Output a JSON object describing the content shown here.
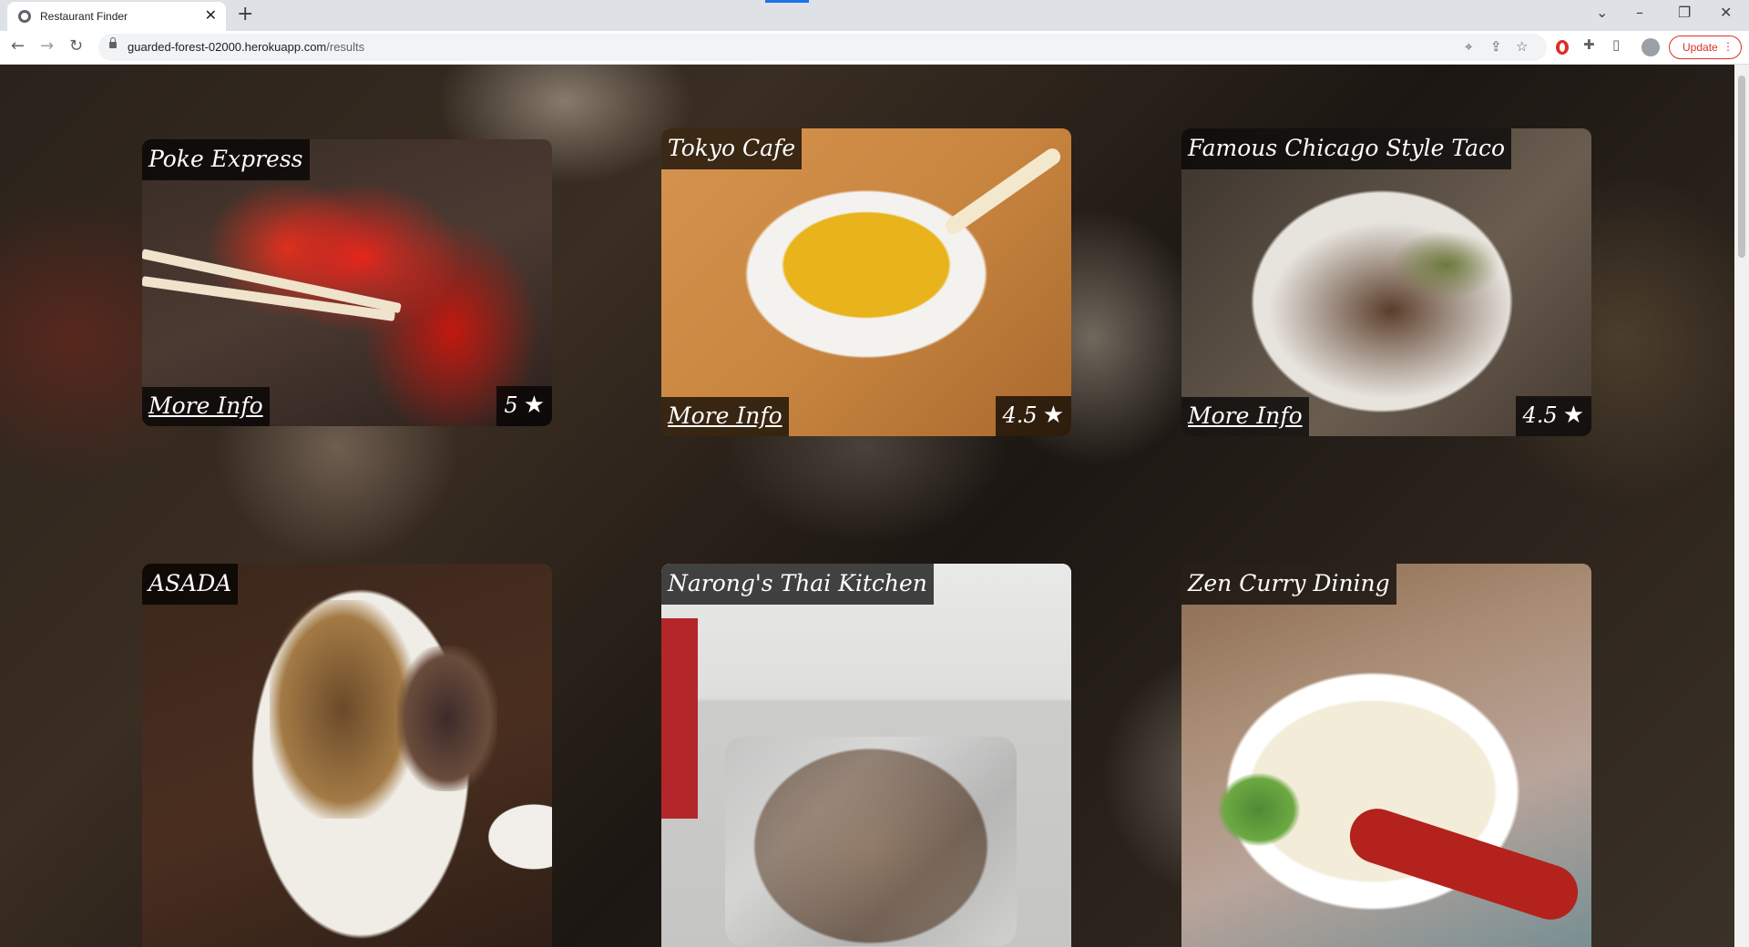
{
  "browser": {
    "tab_title": "Restaurant Finder",
    "tab_close": "✕",
    "new_tab": "+",
    "url_host": "guarded-forest-02000.herokuapp.com",
    "url_path": "/results",
    "update_label": "Update",
    "update_menu": "⋮",
    "nav_back": "←",
    "nav_forward": "→",
    "nav_reload": "↻",
    "win_minimize": "–",
    "win_maximize": "❐",
    "win_close": "✕",
    "tab_search": "⌄"
  },
  "restaurants": [
    {
      "name": "Poke Express",
      "more_info": "More Info",
      "rating": "5",
      "star": "★"
    },
    {
      "name": "Tokyo Cafe",
      "more_info": "More Info",
      "rating": "4.5",
      "star": "★"
    },
    {
      "name": "Famous Chicago Style Taco",
      "more_info": "More Info",
      "rating": "4.5",
      "star": "★"
    },
    {
      "name": "ASADA"
    },
    {
      "name": "Narong's Thai Kitchen"
    },
    {
      "name": "Zen Curry Dining"
    }
  ]
}
